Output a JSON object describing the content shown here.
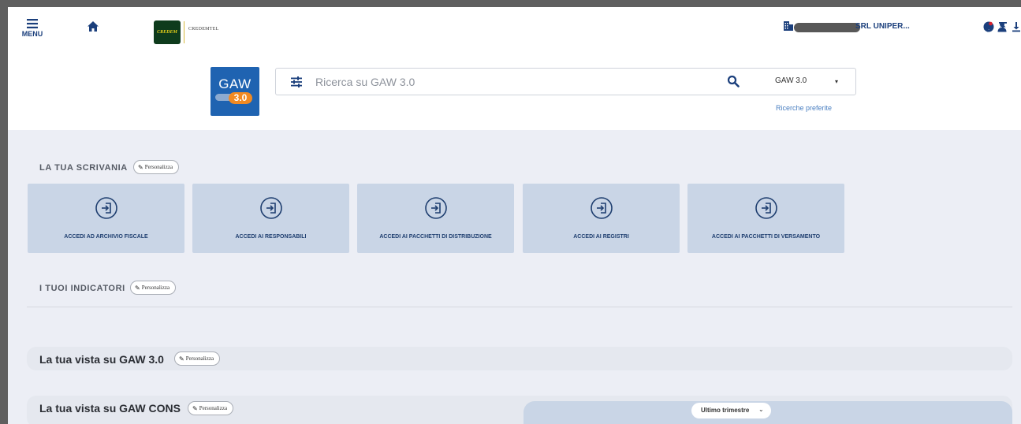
{
  "header": {
    "menu_label": "MENU",
    "credem_logo_text": "CREDEM",
    "credemtel_logo_text": "CREDEMTEL",
    "company_name": "SRL UNIPER...",
    "utility_icons": [
      "help-icon",
      "upload-icon",
      "download-icon",
      "notifications-icon",
      "user-icon"
    ]
  },
  "gaw_logo": {
    "text": "GAW",
    "version": "3.0"
  },
  "search": {
    "placeholder": "Ricerca su GAW 3.0",
    "scope": "GAW 3.0",
    "favorites_link": "Ricerche preferite"
  },
  "scrivania": {
    "title": "LA TUA SCRIVANIA",
    "personalize_label": "Personalizza",
    "cards": [
      {
        "label": "ACCEDI AD ARCHIVIO FISCALE"
      },
      {
        "label": "ACCEDI AI RESPONSABILI"
      },
      {
        "label": "ACCEDI AI PACCHETTI DI DISTRIBUZIONE"
      },
      {
        "label": "ACCEDI AI REGISTRI"
      },
      {
        "label": "ACCEDI AI PACCHETTI DI VERSAMENTO"
      }
    ]
  },
  "indicatori": {
    "title": "I TUOI INDICATORI",
    "personalize_label": "Personalizza"
  },
  "vista_gaw": {
    "title": "La tua vista su GAW 3.0",
    "personalize_label": "Personalizza"
  },
  "vista_cons": {
    "title": "La tua vista su GAW CONS",
    "personalize_label": "Personalizza",
    "period": "Ultimo trimestre"
  },
  "colors": {
    "primary": "#1b3f7c",
    "page_background": "#eceef5",
    "card_background": "#c9d5e6",
    "gaw_blue": "#1f63b1",
    "gaw_orange": "#f28a22",
    "link": "#4a7fc1"
  }
}
